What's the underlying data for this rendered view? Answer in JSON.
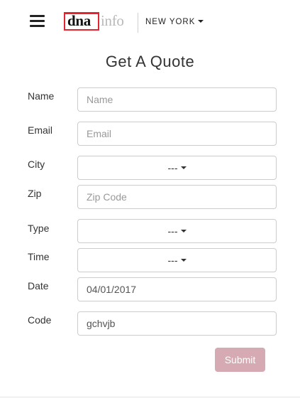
{
  "header": {
    "logo_primary": "dna",
    "logo_secondary": "info",
    "city": "NEW YORK"
  },
  "form": {
    "title": "Get A Quote",
    "fields": {
      "name": {
        "label": "Name",
        "placeholder": "Name",
        "value": ""
      },
      "email": {
        "label": "Email",
        "placeholder": "Email",
        "value": ""
      },
      "city": {
        "label": "City",
        "selected": "---"
      },
      "zip": {
        "label": "Zip",
        "placeholder": "Zip Code",
        "value": ""
      },
      "type": {
        "label": "Type",
        "selected": "---"
      },
      "time": {
        "label": "Time",
        "selected": "---"
      },
      "date": {
        "label": "Date",
        "placeholder": "",
        "value": "04/01/2017"
      },
      "code": {
        "label": "Code",
        "placeholder": "",
        "value": "gchvjb"
      }
    },
    "submit_label": "Submit"
  },
  "icons": {
    "menu": "hamburger-menu-icon",
    "dropdown": "caret-down-icon"
  },
  "colors": {
    "logo_red": "#e2252f",
    "submit_bg": "#d6aab3",
    "text": "#333333",
    "input_border": "#cccccc"
  }
}
